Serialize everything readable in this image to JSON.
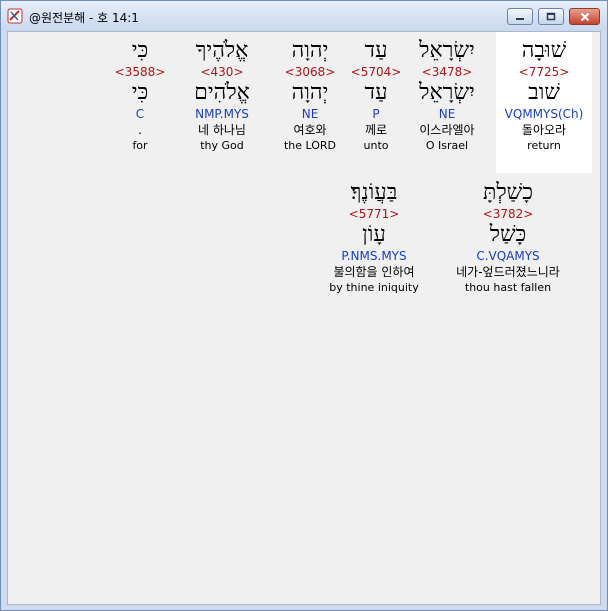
{
  "window": {
    "title": "@원전분해 - 호 14:1"
  },
  "words": [
    {
      "hebrew": "שׁוּבָה",
      "strong": "<7725>",
      "root": "שׁוב",
      "morph": "VQMMYS(Ch)",
      "korean": "돌아오라",
      "english": "return",
      "highlighted": true
    },
    {
      "hebrew": "יִשְׂרָאֵל",
      "strong": "<3478>",
      "root": "יִשְׂרָאֵל",
      "morph": "NE",
      "korean": "이스라엘아",
      "english": "O Israel"
    },
    {
      "hebrew": "עַד",
      "strong": "<5704>",
      "root": "עַד",
      "morph": "P",
      "korean": "께로",
      "english": "unto"
    },
    {
      "hebrew": "יְהוָה",
      "strong": "<3068>",
      "root": "יְהוָה",
      "morph": "NE",
      "korean": "여호와",
      "english": "the LORD"
    },
    {
      "hebrew": "אֱלֹהֶיךָ",
      "strong": "<430>",
      "root": "אֱלֹהִים",
      "morph": "NMP.MYS",
      "korean": "네 하나님",
      "english": "thy God"
    },
    {
      "hebrew": "כִּי",
      "strong": "<3588>",
      "root": "כִּי",
      "morph": "C",
      "korean": ".",
      "english": "for"
    },
    {
      "hebrew": "כָשַׁלְתָּ",
      "strong": "<3782>",
      "root": "כָּשַׁל",
      "morph": "C.VQAMYS",
      "korean": "네가-엎드러졌느니라",
      "english": "thou hast fallen"
    },
    {
      "hebrew": "בַּעֲוֹנֶךָ׃",
      "strong": "<5771>",
      "root": "עָוֹן",
      "morph": "P.NMS.MYS",
      "korean": "불의함을 인하여",
      "english": "by thine iniquity"
    }
  ]
}
